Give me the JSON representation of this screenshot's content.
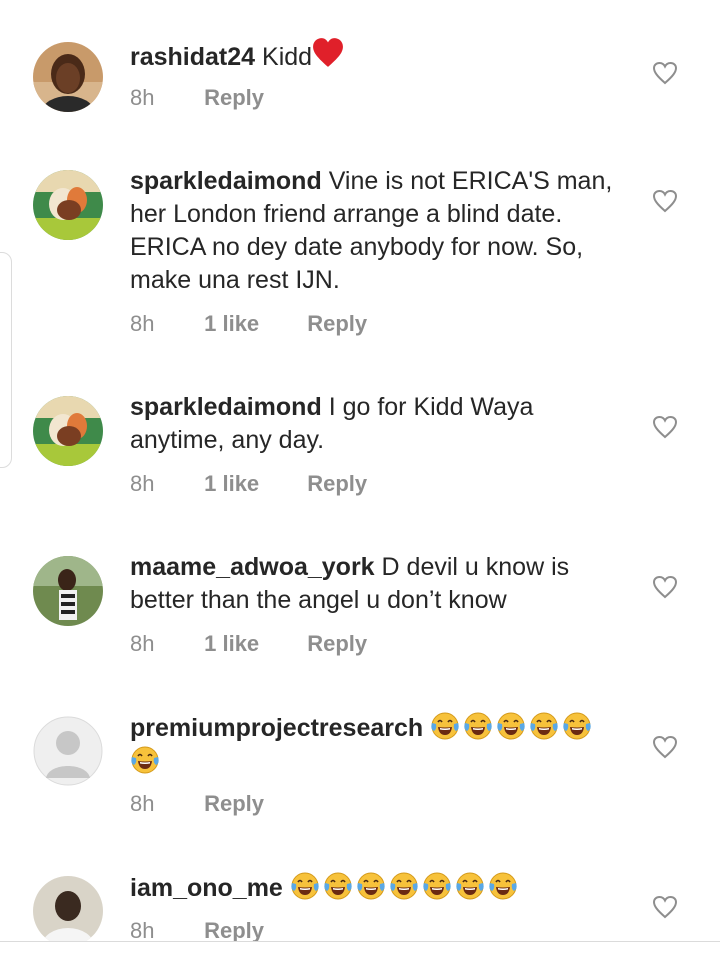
{
  "comments": [
    {
      "username": "rashidat24",
      "text": "Kidd",
      "time": "8h",
      "likes": "",
      "reply": "Reply",
      "extra": "heart-emoji"
    },
    {
      "username": "sparkledaimond",
      "text": "Vine is not ERICA'S man, her London friend arrange a blind date. ERICA no dey date anybody for now. So, make una rest IJN.",
      "time": "8h",
      "likes": "1 like",
      "reply": "Reply"
    },
    {
      "username": "sparkledaimond",
      "text": "I go for Kidd Waya anytime, any day.",
      "time": "8h",
      "likes": "1 like",
      "reply": "Reply"
    },
    {
      "username": "maame_adwoa_york",
      "text": "D devil u know is better than the angel u don’t know",
      "time": "8h",
      "likes": "1 like",
      "reply": "Reply"
    },
    {
      "username": "premiumprojectresearch",
      "text": "",
      "time": "8h",
      "likes": "",
      "reply": "Reply",
      "emoji_count": 6
    },
    {
      "username": "iam_ono_me",
      "text": "",
      "time": "8h",
      "likes": "",
      "reply": "Reply",
      "emoji_count": 7
    }
  ],
  "icons": {
    "like": "heart-outline-icon",
    "emoji": "tears-of-joy-emoji",
    "red_heart": "red-heart-emoji"
  },
  "colors": {
    "text": "#262626",
    "meta": "#8e8e8e",
    "emoji_yellow": "#f7c23b",
    "heart_red": "#e0202a"
  }
}
